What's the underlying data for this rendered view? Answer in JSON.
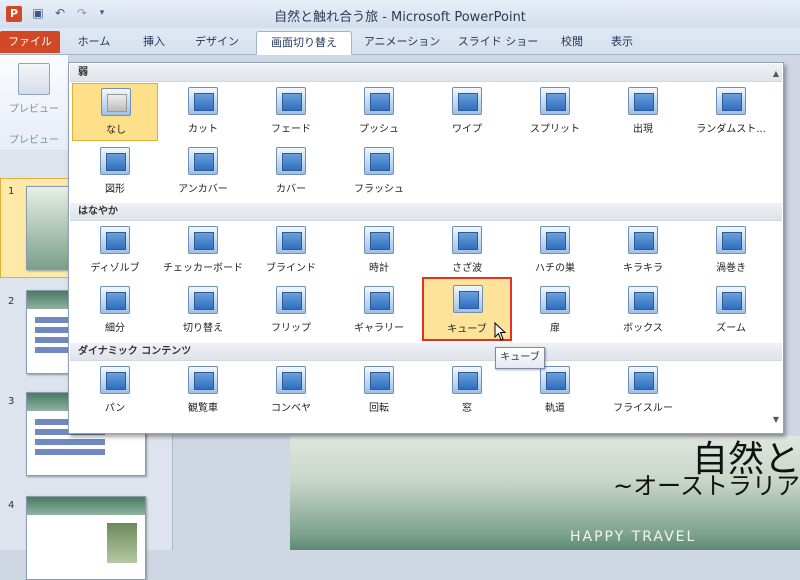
{
  "window": {
    "title": "自然と触れ合う旅 - Microsoft PowerPoint",
    "app_icon": "P",
    "quick_access": [
      "save-icon",
      "undo-icon",
      "redo-icon"
    ]
  },
  "tabs": [
    {
      "label": "ファイル",
      "kind": "file"
    },
    {
      "label": "ホーム"
    },
    {
      "label": "挿入"
    },
    {
      "label": "デザイン"
    },
    {
      "label": "画面切り替え",
      "active": true
    },
    {
      "label": "アニメーション"
    },
    {
      "label": "スライド ショー"
    },
    {
      "label": "校閲"
    },
    {
      "label": "表示"
    }
  ],
  "ribbon": {
    "preview_label": "プレビュー",
    "preview_group": "プレビュー"
  },
  "gallery": {
    "sections": [
      {
        "title": "弱",
        "items": [
          {
            "label": "なし",
            "state": "hover"
          },
          {
            "label": "カット"
          },
          {
            "label": "フェード"
          },
          {
            "label": "プッシュ"
          },
          {
            "label": "ワイプ"
          },
          {
            "label": "スプリット"
          },
          {
            "label": "出現"
          },
          {
            "label": "ランダムスト..."
          },
          {
            "label": "図形"
          },
          {
            "label": "アンカバー"
          },
          {
            "label": "カバー"
          },
          {
            "label": "フラッシュ"
          }
        ]
      },
      {
        "title": "はなやか",
        "items": [
          {
            "label": "ディゾルブ"
          },
          {
            "label": "チェッカーボード"
          },
          {
            "label": "ブラインド"
          },
          {
            "label": "時計"
          },
          {
            "label": "さざ波"
          },
          {
            "label": "ハチの巣"
          },
          {
            "label": "キラキラ"
          },
          {
            "label": "渦巻き"
          },
          {
            "label": "細分"
          },
          {
            "label": "切り替え"
          },
          {
            "label": "フリップ"
          },
          {
            "label": "ギャラリー"
          },
          {
            "label": "キューブ",
            "state": "selected"
          },
          {
            "label": "扉"
          },
          {
            "label": "ボックス"
          },
          {
            "label": "ズーム"
          }
        ]
      },
      {
        "title": "ダイナミック コンテンツ",
        "items": [
          {
            "label": "パン"
          },
          {
            "label": "観覧車"
          },
          {
            "label": "コンベヤ"
          },
          {
            "label": "回転"
          },
          {
            "label": "窓"
          },
          {
            "label": "軌道"
          },
          {
            "label": "フライスルー"
          }
        ]
      }
    ],
    "tooltip": "キューブ"
  },
  "slides": [
    {
      "number": "1"
    },
    {
      "number": "2"
    },
    {
      "number": "3"
    },
    {
      "number": "4"
    }
  ],
  "current_slide": {
    "title": "自然と",
    "subtitle": "~オーストラリア",
    "footer": "HAPPY TRAVEL"
  }
}
